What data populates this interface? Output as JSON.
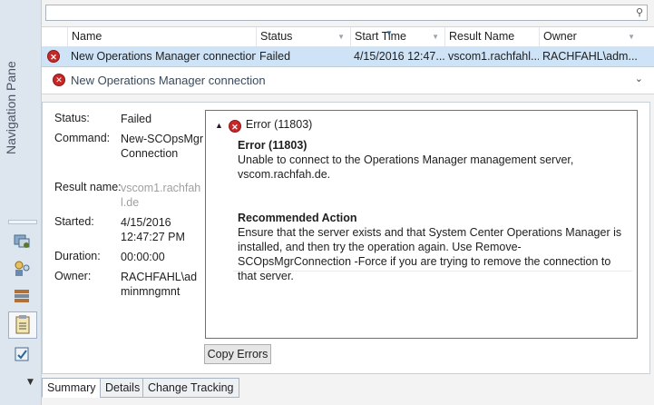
{
  "nav": {
    "title": "Navigation Pane"
  },
  "grid": {
    "columns": [
      "Name",
      "Status",
      "Start Time",
      "Result Name",
      "Owner"
    ],
    "row": {
      "name": "New Operations Manager connection",
      "status": "Failed",
      "start_time": "4/15/2016 12:47...",
      "result_name": "vscom1.rachfahl...",
      "owner": "RACHFAHL\\adm..."
    }
  },
  "detail": {
    "title": "New Operations Manager connection",
    "props": {
      "status_label": "Status:",
      "status_value": "Failed",
      "command_label": "Command:",
      "command_value": "New-SCOpsMgrConnection",
      "result_label": "Result name:",
      "result_value": "vscom1.rachfahl.de",
      "started_label": "Started:",
      "started_value": "4/15/2016 12:47:27 PM",
      "duration_label": "Duration:",
      "duration_value": "00:00:00",
      "owner_label": "Owner:",
      "owner_value": "RACHFAHL\\adminmngmnt"
    },
    "error": {
      "header": "Error (11803)",
      "title": "Error (11803)",
      "message": "Unable to connect to the Operations Manager management server, vscom.rachfah.de.",
      "action_title": "Recommended Action",
      "action_text": "Ensure that the server exists and that System Center Operations Manager is installed, and then try the operation again. Use Remove-SCOpsMgrConnection -Force if you are trying to remove the connection to that server."
    },
    "copy_button": "Copy Errors"
  },
  "tabs": [
    "Summary",
    "Details",
    "Change Tracking"
  ],
  "icons": {
    "error": "error-circle-icon",
    "search": "search-icon",
    "expand": "chevron-down-icon",
    "collapse": "caret-up-icon"
  },
  "colors": {
    "selection": "#cfe3f7",
    "error": "#c62828"
  }
}
